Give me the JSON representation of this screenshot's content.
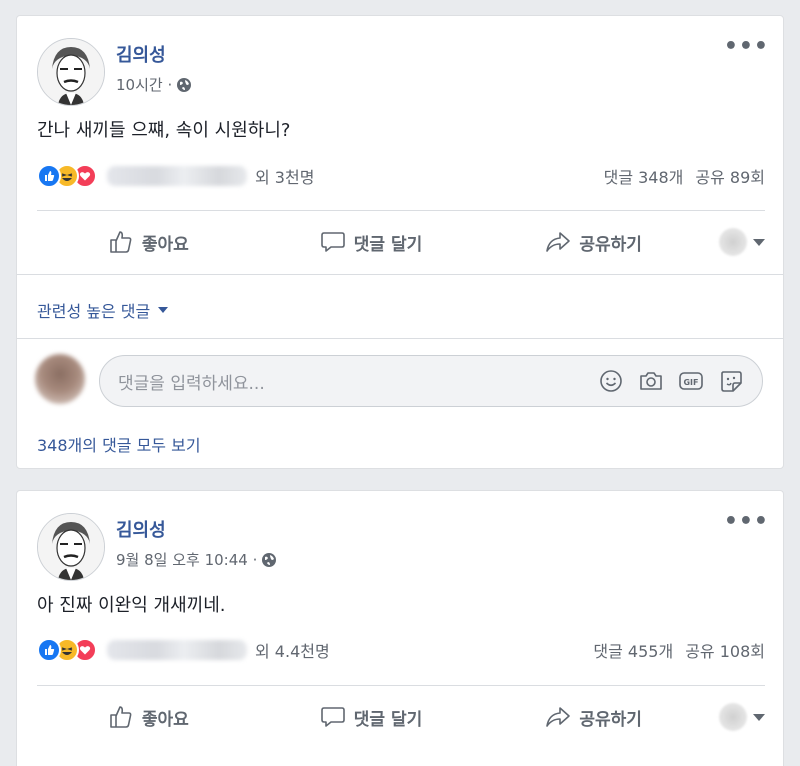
{
  "posts": [
    {
      "author": "김의성",
      "time": "10시간 ·",
      "text": "간나 새끼들 으쨰, 속이 시원하니?",
      "reactions": {
        "others": "외 3천명",
        "comments": "댓글 348개",
        "shares": "공유 89회"
      },
      "actions": {
        "like": "좋아요",
        "comment": "댓글 달기",
        "share": "공유하기"
      },
      "relevant_label": "관련성 높은 댓글",
      "comment_placeholder": "댓글을 입력하세요...",
      "view_all_comments": "348개의 댓글 모두 보기"
    },
    {
      "author": "김의성",
      "time": "9월 8일 오후 10:44 ·",
      "text": "아 진짜 이완익 개새끼네.",
      "reactions": {
        "others": "외 4.4천명",
        "comments": "댓글 455개",
        "shares": "공유 108회"
      },
      "actions": {
        "like": "좋아요",
        "comment": "댓글 달기",
        "share": "공유하기"
      }
    }
  ],
  "icons": {
    "reaction_like": "thumbs-up-icon",
    "reaction_haha": "laughing-face-icon",
    "reaction_love": "heart-icon",
    "privacy": "globe-icon",
    "more": "more-options-icon",
    "comment_tools": [
      "emoji-icon",
      "camera-icon",
      "gif-icon",
      "sticker-icon"
    ]
  },
  "colors": {
    "link": "#365899",
    "like_blue": "#1877f2",
    "haha_yellow": "#f7b928",
    "love_red": "#f33e58",
    "page_bg": "#e9ebee"
  }
}
